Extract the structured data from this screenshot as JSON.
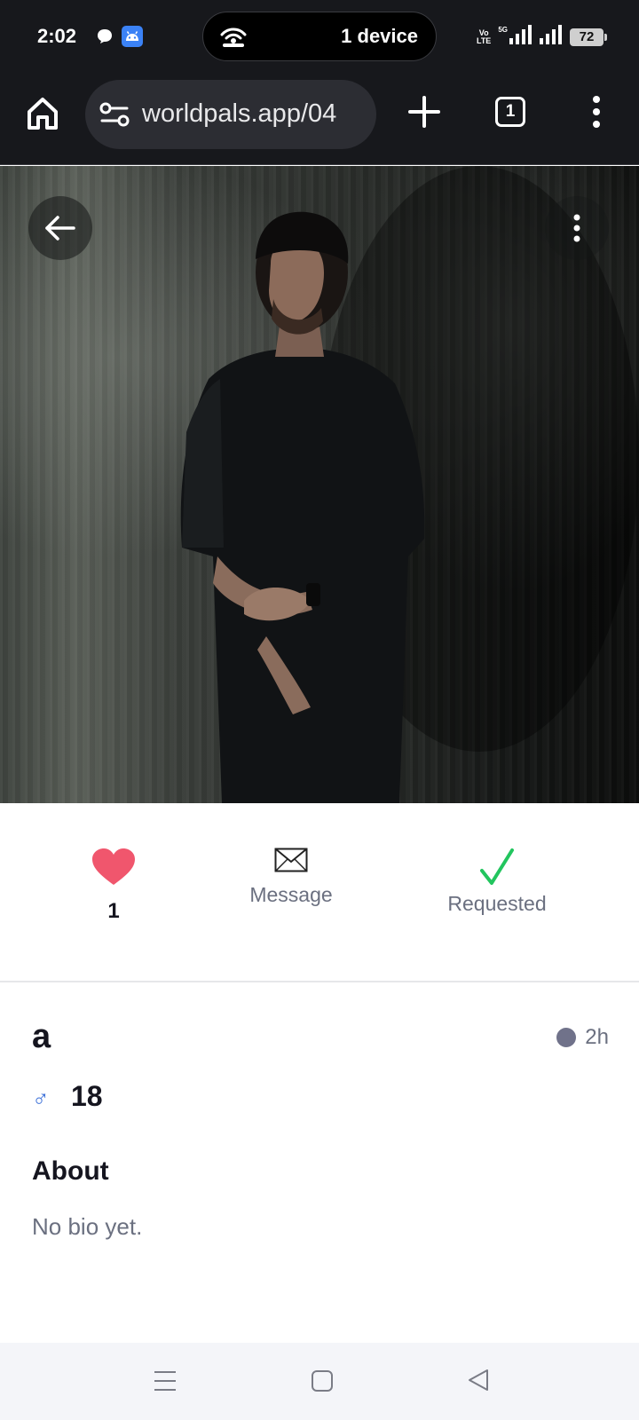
{
  "status_bar": {
    "time": "2:02",
    "pill_text": "1 device",
    "volte_line1": "Vo",
    "volte_line2": "LTE",
    "network": "5G",
    "battery": "72"
  },
  "browser": {
    "url": "worldpals.app/04",
    "tab_count": "1"
  },
  "profile_photo": {
    "back_icon": "arrow-left-icon",
    "more_icon": "more-vertical-icon"
  },
  "actions": {
    "like": {
      "icon": "heart-icon",
      "count": "1",
      "color": "#f0566d"
    },
    "message": {
      "icon": "envelope-icon",
      "label": "Message"
    },
    "requested": {
      "icon": "checkmark-icon",
      "label": "Requested",
      "color": "#22c55e"
    }
  },
  "profile": {
    "name": "a",
    "last_seen": "2h",
    "gender_symbol": "♂",
    "age": "18",
    "about_heading": "About",
    "bio": "No bio yet."
  },
  "nav_bar": {
    "icons": [
      "recents-icon",
      "home-icon",
      "back-icon"
    ]
  }
}
